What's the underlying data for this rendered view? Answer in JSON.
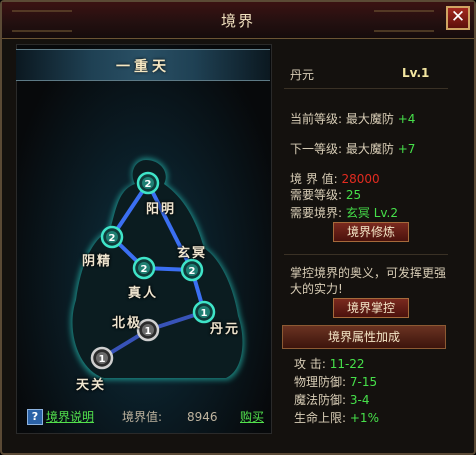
{
  "window": {
    "title": "境界",
    "close_icon": "close-icon"
  },
  "realm": {
    "banner": "一重天",
    "nodes": [
      {
        "name": "阳明",
        "level": "2"
      },
      {
        "name": "阴精",
        "level": "2"
      },
      {
        "name": "真人",
        "level": "2"
      },
      {
        "name": "玄冥",
        "level": "2"
      },
      {
        "name": "丹元",
        "level": "1"
      },
      {
        "name": "北极",
        "level": "1"
      },
      {
        "name": "天关",
        "level": "1"
      }
    ]
  },
  "footer": {
    "help_label": "境界说明",
    "value_label": "境界值:",
    "value": "8946",
    "buy_label": "购买"
  },
  "detail": {
    "node_name": "丹元",
    "level": "Lv.1",
    "current_label": "当前等级:",
    "current_stat": "最大魔防",
    "current_bonus": "+4",
    "next_label": "下一等级:",
    "next_stat": "最大魔防",
    "next_bonus": "+7",
    "realm_value_label": "境 界 值:",
    "realm_value": "28000",
    "req_level_label": "需要等级:",
    "req_level": "25",
    "req_realm_label": "需要境界:",
    "req_realm": "玄冥 Lv.2",
    "cultivate_button": "境界修炼",
    "mastery_text": "掌控境界的奥义，可发挥更强大的实力!",
    "master_button": "境界掌控",
    "attr_header": "境界属性加成",
    "attributes": [
      {
        "label": "攻    击:",
        "value": "11-22"
      },
      {
        "label": "物理防御:",
        "value": "7-15"
      },
      {
        "label": "魔法防御:",
        "value": "3-4"
      },
      {
        "label": "生命上限:",
        "value": "+1%"
      }
    ]
  },
  "colors": {
    "accent_green": "#46e04a",
    "accent_red": "#e22b20",
    "node_glow": "#2fd4c2"
  }
}
